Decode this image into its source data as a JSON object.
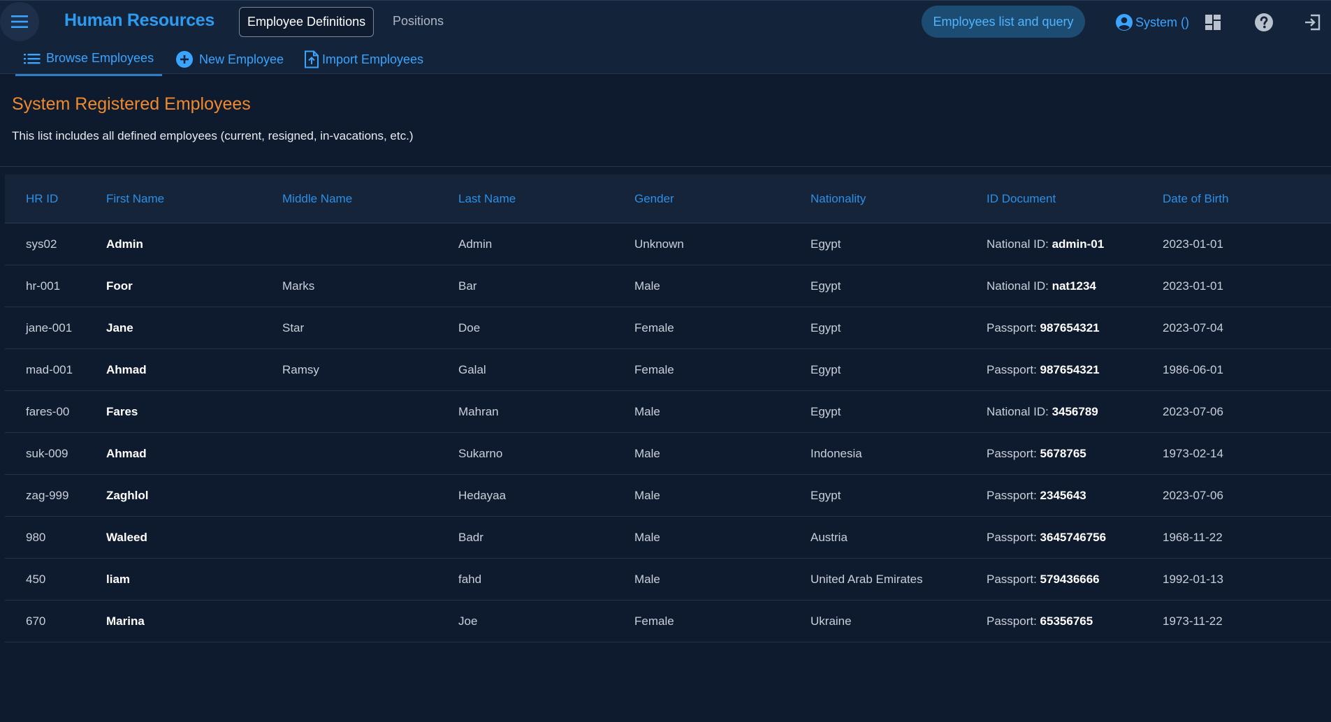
{
  "header": {
    "app_title": "Human Resources",
    "tabs": [
      {
        "label": "Employee Definitions",
        "active": true
      },
      {
        "label": "Positions",
        "active": false
      }
    ],
    "query_button": "Employees list and query",
    "user_label": "System ()"
  },
  "subnav": {
    "items": [
      {
        "label": "Browse Employees",
        "icon": "list-icon",
        "active": true
      },
      {
        "label": "New Employee",
        "icon": "add-circle-icon",
        "active": false
      },
      {
        "label": "Import Employees",
        "icon": "file-upload-icon",
        "active": false
      }
    ]
  },
  "page": {
    "heading": "System Registered Employees",
    "description": "This list includes all defined employees (current, resigned, in-vacations, etc.)"
  },
  "table": {
    "columns": [
      "HR ID",
      "First Name",
      "Middle Name",
      "Last Name",
      "Gender",
      "Nationality",
      "ID Document",
      "Date of Birth"
    ],
    "rows": [
      {
        "hr_id": "sys02",
        "first": "Admin",
        "middle": "",
        "last": "Admin",
        "gender": "Unknown",
        "nationality": "Egypt",
        "doc_type": "National ID:",
        "doc_no": "admin-01",
        "dob": "2023-01-01"
      },
      {
        "hr_id": "hr-001",
        "first": "Foor",
        "middle": "Marks",
        "last": "Bar",
        "gender": "Male",
        "nationality": "Egypt",
        "doc_type": "National ID:",
        "doc_no": "nat1234",
        "dob": "2023-01-01"
      },
      {
        "hr_id": "jane-001",
        "first": "Jane",
        "middle": "Star",
        "last": "Doe",
        "gender": "Female",
        "nationality": "Egypt",
        "doc_type": "Passport:",
        "doc_no": "987654321",
        "dob": "2023-07-04"
      },
      {
        "hr_id": "mad-001",
        "first": "Ahmad",
        "middle": "Ramsy",
        "last": "Galal",
        "gender": "Female",
        "nationality": "Egypt",
        "doc_type": "Passport:",
        "doc_no": "987654321",
        "dob": "1986-06-01"
      },
      {
        "hr_id": "fares-00",
        "first": "Fares",
        "middle": "",
        "last": "Mahran",
        "gender": "Male",
        "nationality": "Egypt",
        "doc_type": "National ID:",
        "doc_no": "3456789",
        "dob": "2023-07-06"
      },
      {
        "hr_id": "suk-009",
        "first": "Ahmad",
        "middle": "",
        "last": "Sukarno",
        "gender": "Male",
        "nationality": "Indonesia",
        "doc_type": "Passport:",
        "doc_no": "5678765",
        "dob": "1973-02-14"
      },
      {
        "hr_id": "zag-999",
        "first": "Zaghlol",
        "middle": "",
        "last": "Hedayaa",
        "gender": "Male",
        "nationality": "Egypt",
        "doc_type": "Passport:",
        "doc_no": "2345643",
        "dob": "2023-07-06"
      },
      {
        "hr_id": "980",
        "first": "Waleed",
        "middle": "",
        "last": "Badr",
        "gender": "Male",
        "nationality": "Austria",
        "doc_type": "Passport:",
        "doc_no": "3645746756",
        "dob": "1968-11-22"
      },
      {
        "hr_id": "450",
        "first": "liam",
        "middle": "",
        "last": "fahd",
        "gender": "Male",
        "nationality": "United Arab Emirates",
        "doc_type": "Passport:",
        "doc_no": "579436666",
        "dob": "1992-01-13"
      },
      {
        "hr_id": "670",
        "first": "Marina",
        "middle": "",
        "last": "Joe",
        "gender": "Female",
        "nationality": "Ukraine",
        "doc_type": "Passport:",
        "doc_no": "65356765",
        "dob": "1973-11-22"
      }
    ]
  }
}
